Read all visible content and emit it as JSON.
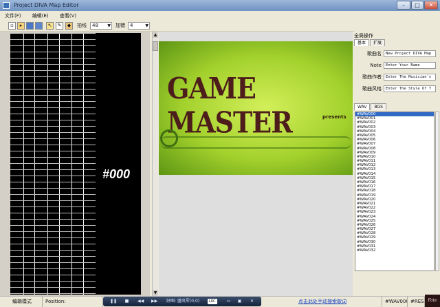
{
  "window": {
    "title": "Project DIVA Map Editor",
    "buttons": {
      "minimize": "–",
      "maximize": "□",
      "close": "✕"
    }
  },
  "menu": [
    "文件(F)",
    "编辑(E)",
    "查看(V)"
  ],
  "toolbar": {
    "icons": [
      "new-icon",
      "open-icon",
      "save-icon",
      "save-as-icon",
      "select-icon",
      "pencil-icon",
      "eraser-icon"
    ],
    "beat_label": "拍线",
    "beat_value": "48",
    "add_label": "加错",
    "add_value": "4"
  },
  "editor": {
    "marker": "#000"
  },
  "preview": {
    "banner_title": "GAME MASTER",
    "banner_subtitle": "presents"
  },
  "panel": {
    "title": "全局操作",
    "tabs": [
      "基本",
      "扩展"
    ],
    "properties": [
      {
        "label": "歌曲名",
        "value": "New Project DIVA Map"
      },
      {
        "label": "Note",
        "value": "Enter Your Name"
      },
      {
        "label": "歌曲作者",
        "value": "Enter The Musician's"
      },
      {
        "label": "歌曲风格",
        "value": "Enter The Style Of T"
      }
    ],
    "list_tabs": [
      "WAV",
      "BGS"
    ],
    "wav_items": [
      "#WAV000",
      "#WAV001",
      "#WAV002",
      "#WAV003",
      "#WAV004",
      "#WAV005",
      "#WAV006",
      "#WAV007",
      "#WAV008",
      "#WAV009",
      "#WAV010",
      "#WAV011",
      "#WAV012",
      "#WAV013",
      "#WAV014",
      "#WAV015",
      "#WAV016",
      "#WAV017",
      "#WAV018",
      "#WAV019",
      "#WAV020",
      "#WAV021",
      "#WAV022",
      "#WAV023",
      "#WAV024",
      "#WAV025",
      "#WAV026",
      "#WAV027",
      "#WAV028",
      "#WAV029",
      "#WAV030",
      "#WAV031",
      "#WAV032"
    ],
    "selected_index": 0
  },
  "status": {
    "mode": "编辑模式",
    "position_label": "Position:",
    "player_text": "好图: 盛风军(0,0)",
    "player_lrc": "LRC",
    "link": "点击此处手动搜索歌词",
    "wav": "#WAV000",
    "res": "#RES0"
  },
  "taskbar": {
    "fate_logo": "Fate"
  }
}
